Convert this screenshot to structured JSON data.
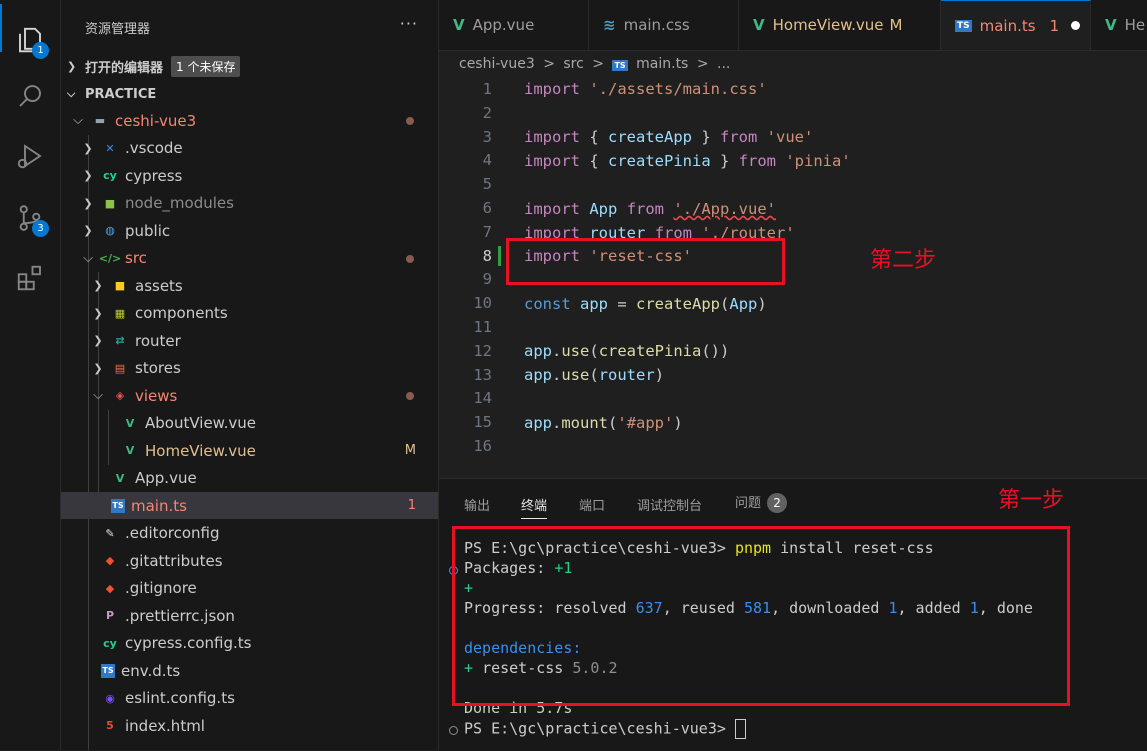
{
  "sidebar": {
    "title": "资源管理器",
    "more": "···",
    "open_editors": {
      "label": "打开的编辑器",
      "badge": "1 个未保存"
    },
    "project": "PRACTICE",
    "tree": [
      {
        "label": "ceshi-vue3",
        "icon": "folder-open-icon",
        "deco": "",
        "color": "#f48771"
      },
      {
        "label": ".vscode",
        "icon": "vscode-folder-icon",
        "deco": "",
        "color": "#cccccc"
      },
      {
        "label": "cypress",
        "icon": "cypress-folder-icon",
        "deco": "",
        "color": "#cccccc"
      },
      {
        "label": "node_modules",
        "icon": "node-folder-icon",
        "deco": "",
        "color": "#8c8c8c"
      },
      {
        "label": "public",
        "icon": "globe-folder-icon",
        "deco": "",
        "color": "#cccccc"
      },
      {
        "label": "src",
        "icon": "src-folder-icon",
        "deco": "",
        "color": "#f48771"
      },
      {
        "label": "assets",
        "icon": "assets-folder-icon",
        "deco": "",
        "color": "#cccccc"
      },
      {
        "label": "components",
        "icon": "components-folder-icon",
        "deco": "",
        "color": "#cccccc"
      },
      {
        "label": "router",
        "icon": "router-folder-icon",
        "deco": "",
        "color": "#cccccc"
      },
      {
        "label": "stores",
        "icon": "stores-folder-icon",
        "deco": "",
        "color": "#cccccc"
      },
      {
        "label": "views",
        "icon": "views-folder-icon",
        "deco": "",
        "color": "#f48771"
      },
      {
        "label": "AboutView.vue",
        "icon": "vue-icon",
        "deco": "",
        "color": "#cccccc"
      },
      {
        "label": "HomeView.vue",
        "icon": "vue-icon",
        "deco": "M",
        "color": "#e2c08d"
      },
      {
        "label": "App.vue",
        "icon": "vue-icon",
        "deco": "",
        "color": "#cccccc"
      },
      {
        "label": "main.ts",
        "icon": "ts-icon",
        "deco": "1",
        "color": "#f48771"
      },
      {
        "label": ".editorconfig",
        "icon": "editorconfig-icon",
        "deco": "",
        "color": "#cccccc"
      },
      {
        "label": ".gitattributes",
        "icon": "git-icon",
        "deco": "",
        "color": "#cccccc"
      },
      {
        "label": ".gitignore",
        "icon": "git-icon",
        "deco": "",
        "color": "#cccccc"
      },
      {
        "label": ".prettierrc.json",
        "icon": "prettier-icon",
        "deco": "",
        "color": "#cccccc"
      },
      {
        "label": "cypress.config.ts",
        "icon": "cypress-icon",
        "deco": "",
        "color": "#cccccc"
      },
      {
        "label": "env.d.ts",
        "icon": "ts-icon",
        "deco": "",
        "color": "#cccccc"
      },
      {
        "label": "eslint.config.ts",
        "icon": "eslint-icon",
        "deco": "",
        "color": "#cccccc"
      },
      {
        "label": "index.html",
        "icon": "html-icon",
        "deco": "",
        "color": "#cccccc"
      }
    ]
  },
  "activity": {
    "explorer_badge": "1",
    "scm_badge": "3"
  },
  "tabs": [
    {
      "label": "App.vue",
      "icon": "V",
      "status": ""
    },
    {
      "label": "main.css",
      "icon": "≋",
      "status": ""
    },
    {
      "label": "HomeView.vue",
      "icon": "V",
      "status": "M"
    },
    {
      "label": "main.ts",
      "icon": "TS",
      "status": "1"
    },
    {
      "label": "He",
      "icon": "V",
      "status": ""
    }
  ],
  "breadcrumb": [
    "ceshi-vue3",
    ">",
    "src",
    ">",
    "main.ts",
    ">",
    "..."
  ],
  "editor": {
    "line_numbers": [
      "1",
      "2",
      "3",
      "4",
      "5",
      "6",
      "7",
      "8",
      "9",
      "10",
      "11",
      "12",
      "13",
      "14",
      "15",
      "16"
    ]
  },
  "panel": {
    "tabs": [
      "输出",
      "终端",
      "端口",
      "调试控制台",
      "问题"
    ],
    "problems_count": "2",
    "terminal": {
      "prompt": "PS E:\\gc\\practice\\ceshi-vue3>",
      "command": "pnpm",
      "args": " install reset-css",
      "packages_label": "Packages: ",
      "packages_value": "+1",
      "plus_line": "+",
      "progress": "Progress: resolved 637, reused 581, downloaded 1, added 1, done",
      "deps_label": "dependencies:",
      "dep_plus": "+ ",
      "dep_name": "reset-css",
      "dep_version": " 5.0.2",
      "done": "Done in 5.7s",
      "prompt2": "PS E:\\gc\\practice\\ceshi-vue3>"
    }
  },
  "annotations": {
    "step1": "第一步",
    "step2": "第二步"
  }
}
